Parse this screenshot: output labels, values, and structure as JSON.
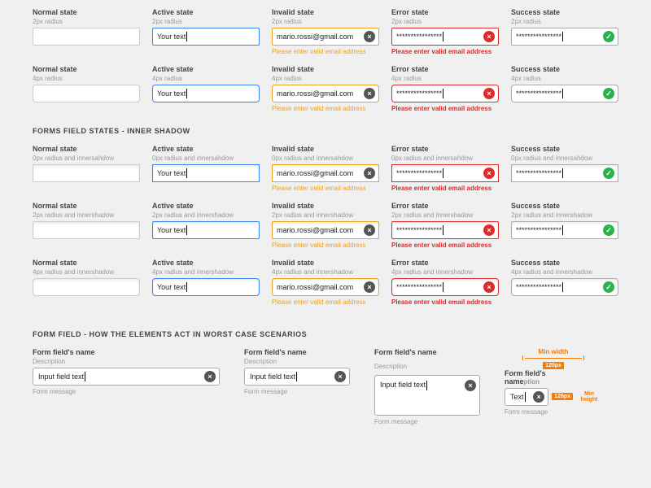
{
  "states": {
    "normal": {
      "title": "Normal state"
    },
    "active": {
      "title": "Active state",
      "value": "Your text"
    },
    "invalid": {
      "title": "Invalid state",
      "value": "mario.rossi@gmail.com",
      "message": "Please enter valid email address"
    },
    "error": {
      "title": "Error state",
      "value": "****************",
      "message": "Please enter valid email address"
    },
    "success": {
      "title": "Success state",
      "value": "****************"
    }
  },
  "radius": {
    "r2": "2px radius",
    "r4": "4px radius",
    "r0is": "0px radius and innersahdow",
    "r2is": "2px radius and innershadow",
    "r4is": "4px radius and innershadow"
  },
  "section_inner": "FORMS FIELD STATES - INNER SHADOW",
  "section_worst": "FORM FIELD - HOW THE ELEMENTS ACT IN WORST CASE SCENARIOS",
  "worst": {
    "name": "Form field's name",
    "desc": "Description",
    "value": "Input field text",
    "value_short": "Text",
    "msg": "Form message"
  },
  "annot": {
    "min_width": "Min width",
    "width_val": "120px",
    "height_val": "126px",
    "min_height": "Min height"
  }
}
